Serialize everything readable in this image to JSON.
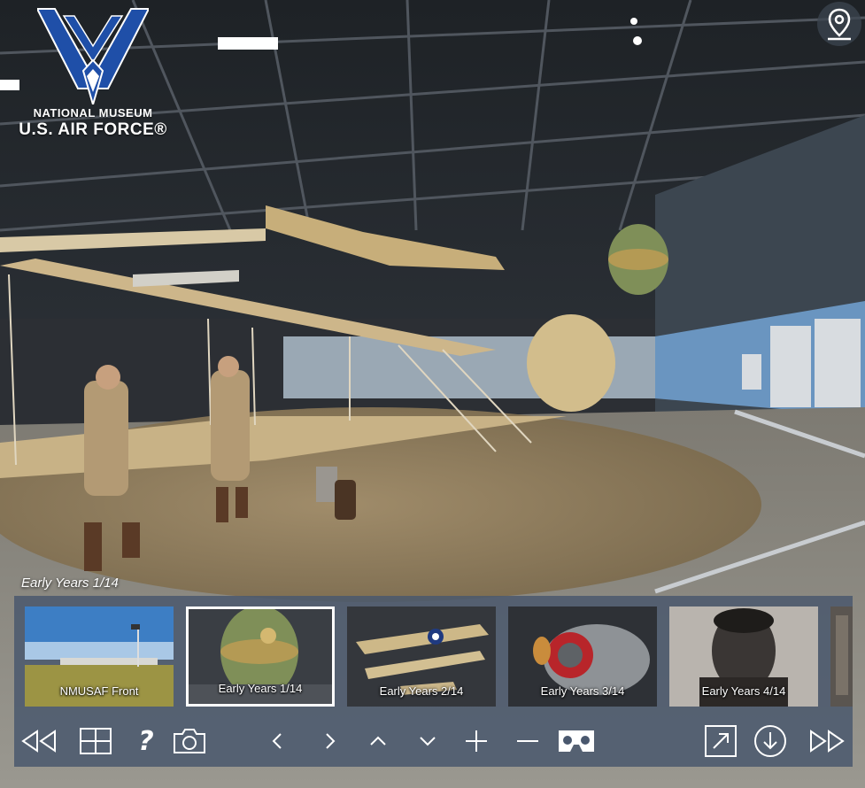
{
  "logo": {
    "line1": "NATIONAL MUSEUM",
    "line2": "U.S. AIR FORCE®"
  },
  "caption": "Early Years 1/14",
  "thumbnails": [
    {
      "label": "NMUSAF Front",
      "active": false
    },
    {
      "label": "Early Years 1/14",
      "active": true
    },
    {
      "label": "Early Years 2/14",
      "active": false
    },
    {
      "label": "Early Years 3/14",
      "active": false
    },
    {
      "label": "Early Years 4/14",
      "active": false
    }
  ],
  "toolbar": {
    "buttons": [
      "rewind-icon",
      "grid-icon",
      "help-icon",
      "camera-icon",
      "chevron-left-icon",
      "chevron-right-icon",
      "chevron-up-icon",
      "chevron-down-icon",
      "zoom-in-icon",
      "zoom-out-icon",
      "vr-headset-icon",
      "fullscreen-icon",
      "download-icon",
      "fast-forward-icon"
    ],
    "help_label": "?"
  },
  "colors": {
    "panel": "#4a586e",
    "active_border": "#ffffff",
    "logo_blue": "#1f4fa8"
  }
}
